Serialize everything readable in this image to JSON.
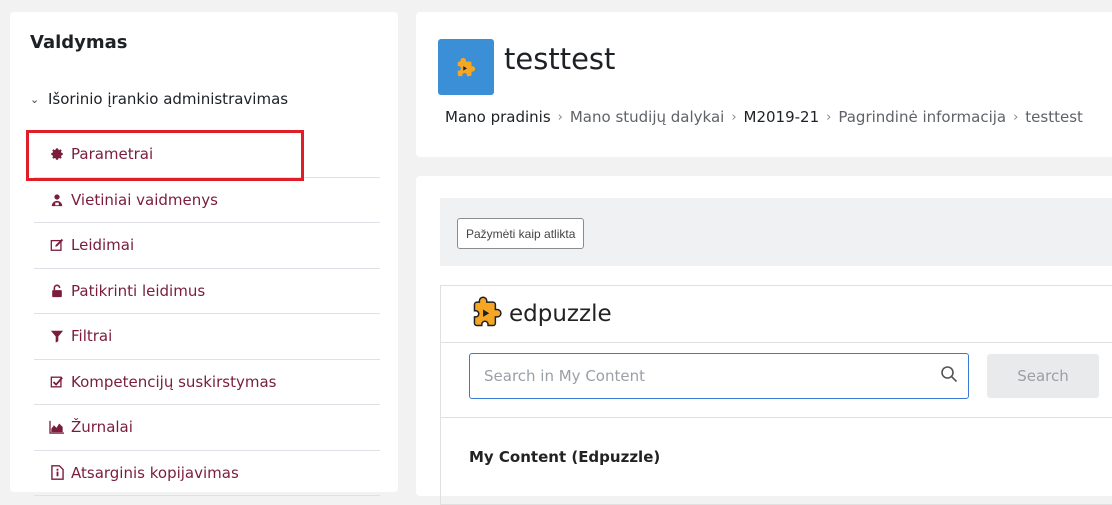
{
  "sidebar": {
    "title": "Valdymas",
    "section": "Išorinio įrankio administravimas",
    "items": [
      {
        "label": "Parametrai",
        "icon": "gear-icon"
      },
      {
        "label": "Vietiniai vaidmenys",
        "icon": "users-icon"
      },
      {
        "label": "Leidimai",
        "icon": "edit-icon"
      },
      {
        "label": "Patikrinti leidimus",
        "icon": "unlock-icon"
      },
      {
        "label": "Filtrai",
        "icon": "filter-icon"
      },
      {
        "label": "Kompetencijų suskirstymas",
        "icon": "checkbox-icon"
      },
      {
        "label": "Žurnalai",
        "icon": "chart-icon"
      },
      {
        "label": "Atsarginis kopijavimas",
        "icon": "backup-file-icon"
      }
    ]
  },
  "header": {
    "title": "testtest",
    "icon": "puzzle-icon",
    "breadcrumb": [
      "Mano pradinis",
      "Mano studijų dalykai",
      "M2019-21",
      "Pagrindinė informacija",
      "testtest"
    ]
  },
  "main": {
    "mark_done_label": "Pažymėti kaip atlikta",
    "edpuzzle": {
      "logo_text": "edpuzzle",
      "search_placeholder": "Search in My Content",
      "search_button": "Search",
      "section_title": "My Content (Edpuzzle)"
    }
  },
  "colors": {
    "accent_link": "#7a1d3b",
    "highlight": "#e11d2a",
    "course_icon_bg": "#3a8fd6",
    "edpuzzle_orange": "#f5a623"
  }
}
